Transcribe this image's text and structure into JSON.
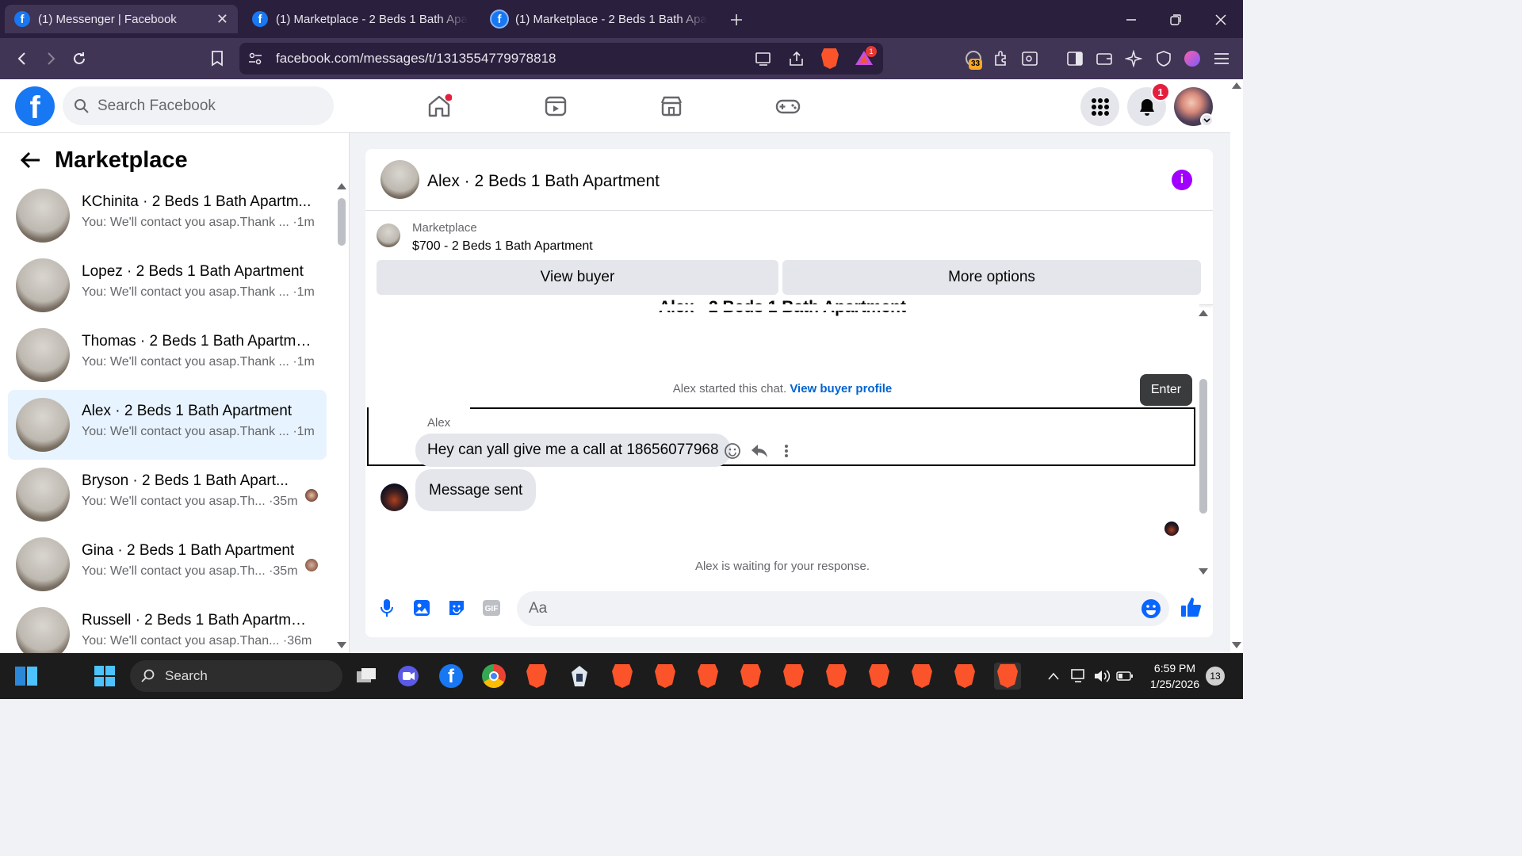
{
  "browser": {
    "tabs": [
      {
        "title": "(1) Messenger | Facebook",
        "active": true
      },
      {
        "title": "(1) Marketplace - 2 Beds 1 Bath Apart",
        "active": false
      },
      {
        "title": "(1) Marketplace - 2 Beds 1 Bath Apart",
        "active": false
      }
    ],
    "url": "facebook.com/messages/t/1313554779978818",
    "rewards_badge": "1",
    "extension_count": "33"
  },
  "fb_header": {
    "logo": "f",
    "search_placeholder": "Search Facebook",
    "notifications_count": "1"
  },
  "left_panel": {
    "title": "Marketplace",
    "conversations": [
      {
        "name": "KChinita · 2 Beds 1 Bath Apartm...",
        "preview": "You: We'll contact you asap.Thank ... ·1m",
        "selected": false
      },
      {
        "name": "Lopez · 2 Beds 1 Bath Apartment",
        "preview": "You: We'll contact you asap.Thank ... ·1m",
        "selected": false
      },
      {
        "name": "Thomas · 2 Beds 1 Bath Apartme...",
        "preview": "You: We'll contact you asap.Thank ... ·1m",
        "selected": false
      },
      {
        "name": "Alex · 2 Beds 1 Bath Apartment",
        "preview": "You: We'll contact you asap.Thank ... ·1m",
        "selected": true
      },
      {
        "name": "Bryson · 2 Beds 1 Bath Apart...",
        "preview": "You: We'll contact you asap.Th... ·35m",
        "selected": false
      },
      {
        "name": "Gina · 2 Beds 1 Bath Apartment",
        "preview": "You: We'll contact you asap.Th... ·35m",
        "selected": false
      },
      {
        "name": "Russell · 2 Beds 1 Bath Apartment",
        "preview": "You: We'll contact you asap.Than... ·36m",
        "selected": false
      }
    ]
  },
  "chat": {
    "header_name": "Alex · 2 Beds 1 Bath Apartment",
    "marketplace_label": "Marketplace",
    "listing": "$700 - 2 Beds 1 Bath Apartment",
    "view_buyer": "View buyer",
    "more_options": "More options",
    "cutoff_title": "Alex · 2 Beds 1 Bath Apartment",
    "started_text": "Alex started this chat.",
    "view_buyer_profile": "View buyer profile",
    "enter_label": "Enter",
    "sender_name": "Alex",
    "incoming_message": "Hey can yall give me a call at 18656077968",
    "outgoing_message": "Message sent",
    "waiting_text": "Alex is waiting for your response.",
    "composer_placeholder": "Aa"
  },
  "taskbar": {
    "search_label": "Search",
    "time": "6:59 PM",
    "date": "1/25/2026",
    "notification_count": "13"
  },
  "colors": {
    "facebook_blue": "#1877f2",
    "selected_bg": "#e7f3ff",
    "brave_orange": "#fb542b",
    "info_purple": "#a100ff",
    "tab_bar": "#2a1f3d"
  }
}
